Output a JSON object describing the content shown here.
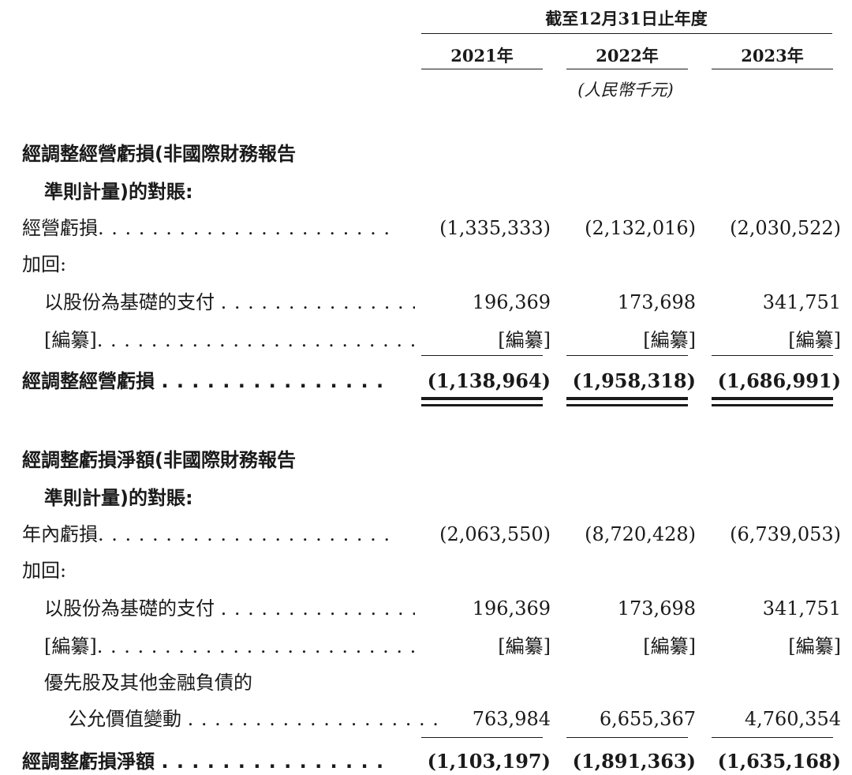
{
  "header": {
    "period": "截至12月31日止年度",
    "years": [
      "2021年",
      "2022年",
      "2023年"
    ],
    "unit": "(人民幣千元)"
  },
  "section1": {
    "heading_line1": "經調整經營虧損(非國際財務報告",
    "heading_line2": "準則計量)的對賬:",
    "rows": [
      {
        "label": "經營虧損",
        "leader": true,
        "indent": 0,
        "values": [
          "(1,335,333)",
          "(2,132,016)",
          "(2,030,522)"
        ]
      },
      {
        "label": "加回:",
        "leader": false,
        "indent": 0,
        "values": []
      },
      {
        "label": "以股份為基礎的支付",
        "leader": true,
        "indent": 1,
        "values": [
          "196,369",
          "173,698",
          "341,751"
        ]
      },
      {
        "label": "[編纂]",
        "leader": true,
        "indent": 1,
        "values": [
          "[編纂]",
          "[編纂]",
          "[編纂]"
        ]
      }
    ],
    "total": {
      "label": "經調整經營虧損",
      "values": [
        "(1,138,964)",
        "(1,958,318)",
        "(1,686,991)"
      ]
    }
  },
  "section2": {
    "heading_line1": "經調整虧損淨額(非國際財務報告",
    "heading_line2": "準則計量)的對賬:",
    "rows": [
      {
        "label": "年內虧損",
        "leader": true,
        "indent": 0,
        "values": [
          "(2,063,550)",
          "(8,720,428)",
          "(6,739,053)"
        ]
      },
      {
        "label": "加回:",
        "leader": false,
        "indent": 0,
        "values": []
      },
      {
        "label": "以股份為基礎的支付",
        "leader": true,
        "indent": 1,
        "values": [
          "196,369",
          "173,698",
          "341,751"
        ]
      },
      {
        "label": "[編纂]",
        "leader": true,
        "indent": 1,
        "values": [
          "[編纂]",
          "[編纂]",
          "[編纂]"
        ]
      },
      {
        "label": "優先股及其他金融負債的",
        "leader": false,
        "indent": 1,
        "values": []
      },
      {
        "label": "公允價值變動",
        "leader": true,
        "indent": 2,
        "values": [
          "763,984",
          "6,655,367",
          "4,760,354"
        ]
      }
    ],
    "total": {
      "label": "經調整虧損淨額",
      "values": [
        "(1,103,197)",
        "(1,891,363)",
        "(1,635,168)"
      ]
    }
  }
}
